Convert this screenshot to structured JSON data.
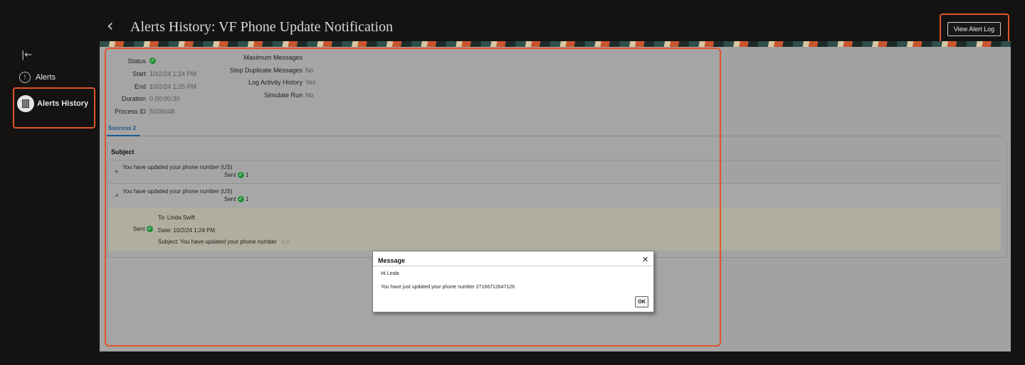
{
  "sidebar": {
    "collapse_icon": "collapse-left-icon",
    "items": [
      {
        "label": "Alerts",
        "icon": "info-circle-icon"
      },
      {
        "label": "Alerts History",
        "icon": "document-icon"
      }
    ]
  },
  "header": {
    "back_icon": "chevron-left-icon",
    "title": "Alerts History: VF Phone Update Notification",
    "view_log_label": "View Alert Log"
  },
  "summary": {
    "status_label": "Status",
    "start_label": "Start",
    "start_value": "10/2/24 1:24 PM",
    "end_label": "End",
    "end_value": "10/2/24 1:25 PM",
    "duration_label": "Duration",
    "duration_value": "0 00:00:30",
    "process_id_label": "Process ID",
    "process_id_value": "5026048",
    "max_messages_label": "Maximum Messages",
    "stop_duplicate_label": "Stop Duplicate Messages",
    "stop_duplicate_value": "No",
    "log_activity_label": "Log Activity History",
    "log_activity_value": "Yes",
    "simulate_run_label": "Simulate Run",
    "simulate_run_value": "No"
  },
  "tabs": [
    {
      "label": "Success 2"
    }
  ],
  "table": {
    "column_header": "Subject",
    "rows": [
      {
        "subject": "You have updated your phone number (US)",
        "status": "Sent",
        "count": "1",
        "expanded": false
      },
      {
        "subject": "You have updated your phone number (US)",
        "status": "Sent",
        "count": "1",
        "expanded": true
      }
    ],
    "detail": {
      "status": "Sent",
      "to": "To: Linda.Swift",
      "date": "Date: 10/2/24 1:24 PM",
      "subject": "Subject: You have updated your phone number",
      "link_icon": "link-icon"
    }
  },
  "dialog": {
    "title": "Message",
    "close_icon": "close-icon",
    "greeting": "Hi Linda",
    "body": "You have just updated your phone number 27166712647126",
    "ok_label": "OK"
  },
  "colors": {
    "highlight": "#e0552b",
    "success": "#1f8f3a",
    "tab_accent": "#1b5a8c"
  }
}
